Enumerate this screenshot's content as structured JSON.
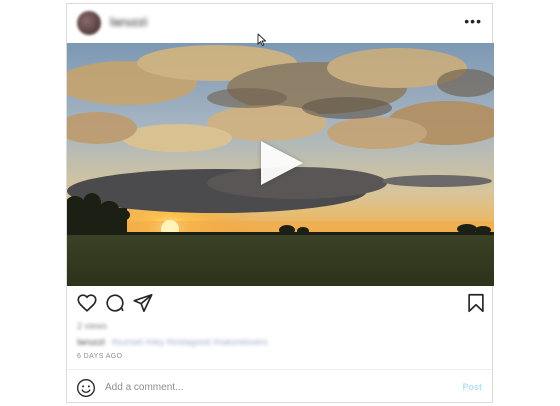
{
  "post": {
    "username": "laruzzi",
    "more_label": "•••",
    "likes": "2 views",
    "caption_user": "laruzzi",
    "caption_text": "#sunset #sky #instagood #naturelovers",
    "timestamp": "6 DAYS AGO"
  },
  "media": {
    "type": "video",
    "description_icon": "play-icon"
  },
  "actions": {
    "icons": [
      "heart-icon",
      "comment-icon",
      "share-icon",
      "bookmark-icon"
    ]
  },
  "comment": {
    "placeholder": "Add a comment...",
    "post_label": "Post"
  },
  "colors": {
    "border": "#dbdbdb",
    "post_button": "#b2dffc",
    "muted_text": "#8e8e8e",
    "primary_text": "#262626"
  }
}
